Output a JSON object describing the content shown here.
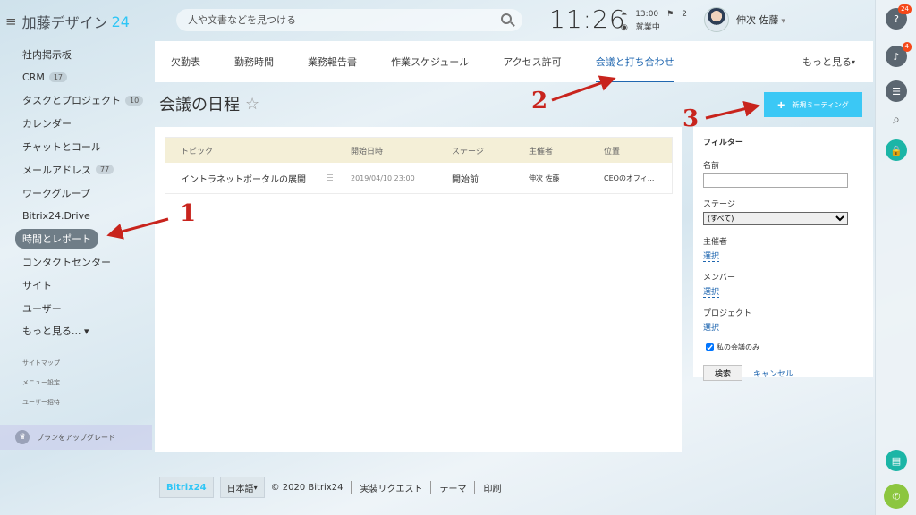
{
  "header": {
    "logo_text": "加藤デザイン",
    "logo_num": "24",
    "search_placeholder": "人や文書などを見つける",
    "clock": "11:26",
    "alarm": "13:00",
    "flag_count": "2",
    "work_status": "就業中",
    "user_name": "伸次 佐藤"
  },
  "rail": {
    "help_badge": "24",
    "bell_badge": "4"
  },
  "sidebar": {
    "items": [
      {
        "label": "社内掲示板",
        "count": ""
      },
      {
        "label": "CRM",
        "count": "17"
      },
      {
        "label": "タスクとプロジェクト",
        "count": "10"
      },
      {
        "label": "カレンダー",
        "count": ""
      },
      {
        "label": "チャットとコール",
        "count": ""
      },
      {
        "label": "メールアドレス",
        "count": "77"
      },
      {
        "label": "ワークグループ",
        "count": ""
      },
      {
        "label": "Bitrix24.Drive",
        "count": ""
      },
      {
        "label": "時間とレポート",
        "count": ""
      },
      {
        "label": "コンタクトセンター",
        "count": ""
      },
      {
        "label": "サイト",
        "count": ""
      },
      {
        "label": "ユーザー",
        "count": ""
      },
      {
        "label": "もっと見る... ▾",
        "count": ""
      }
    ],
    "small_links": [
      "サイトマップ",
      "メニュー設定",
      "ユーザー招待"
    ],
    "upgrade": "プランをアップグレード"
  },
  "tabs": {
    "items": [
      "欠勤表",
      "勤務時間",
      "業務報告書",
      "作業スケジュール",
      "アクセス許可",
      "会議と打ち合わせ"
    ],
    "more": "もっと見る"
  },
  "page": {
    "title": "会議の日程",
    "new_button": "新規ミーティング"
  },
  "table": {
    "headers": [
      "トピック",
      "開始日時",
      "ステージ",
      "主催者",
      "位置"
    ],
    "rows": [
      [
        "イントラネットポータルの展開",
        "2019/04/10 23:00",
        "開始前",
        "伸次 佐藤",
        "CEOのオフィ..."
      ]
    ]
  },
  "filter": {
    "title": "フィルター",
    "name_label": "名前",
    "stage_label": "ステージ",
    "stage_value": "(すべて)",
    "host_label": "主催者",
    "member_label": "メンバー",
    "project_label": "プロジェクト",
    "select_link": "選択",
    "my_meetings": "私の会議のみ",
    "search_btn": "検索",
    "cancel": "キャンセル"
  },
  "footer": {
    "logo": "Bitrix24",
    "lang": "日本語",
    "copyright": "© 2020 Bitrix24",
    "request": "実装リクエスト",
    "theme": "テーマ",
    "print": "印刷"
  },
  "annotations": [
    "1",
    "2",
    "3"
  ],
  "colors": {
    "accent": "#2fc6f6",
    "button": "#3bc8f5",
    "link": "#2067b0",
    "annotation": "#c8241d"
  }
}
